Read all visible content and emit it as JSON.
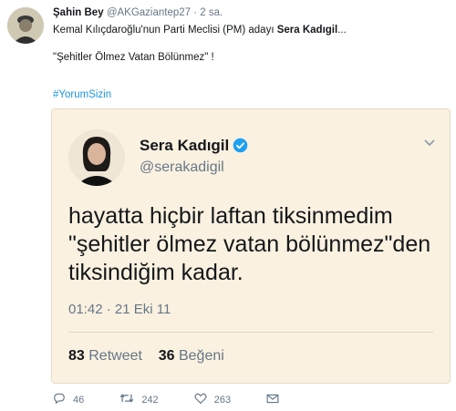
{
  "tweet": {
    "author_name": "Şahin Bey",
    "author_meta": "@AKGaziantep27 · 2 sa.",
    "line1_pre": "Kemal Kılıçdaroğlu'nun Parti Meclisi (PM) adayı ",
    "line1_bold": "Sera Kadıgil",
    "line1_post": "...",
    "line2": "\"Şehitler Ölmez Vatan Bölünmez\" !",
    "hashtag": "#YorumSizin",
    "replies": "46",
    "retweets": "242",
    "likes": "263"
  },
  "quoted": {
    "name": "Sera Kadıgil",
    "handle": "@serakadigil",
    "text": "hayatta hiçbir laftan tiksinmedim \"şehitler ölmez vatan bölünmez\"den tiksindiğim kadar.",
    "time": "01:42 · 21 Eki 11",
    "retweet_count": "83",
    "retweet_label": "Retweet",
    "like_count": "36",
    "like_label": "Beğeni"
  },
  "colors": {
    "link": "#1b95e0",
    "muted": "#657786",
    "embed_bg": "#fbf1e1",
    "verified": "#1da1f2"
  },
  "icons": [
    "reply-icon",
    "retweet-icon",
    "like-icon",
    "direct-message-icon",
    "verified-badge-icon",
    "chevron-down-icon"
  ]
}
